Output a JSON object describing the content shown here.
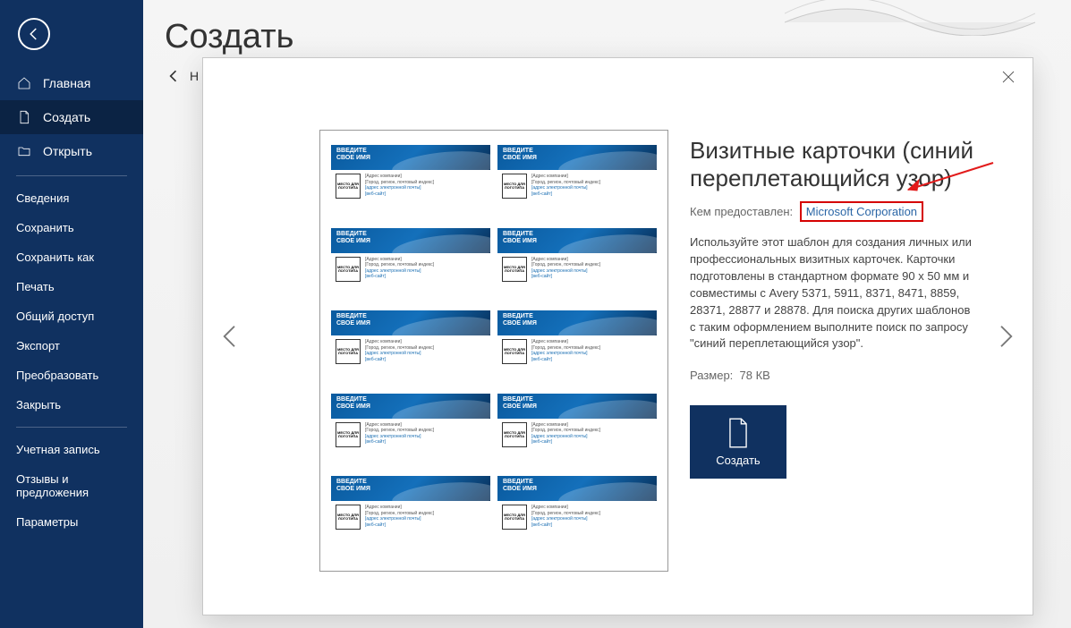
{
  "sidebar": {
    "nav": [
      {
        "label": "Главная"
      },
      {
        "label": "Создать"
      },
      {
        "label": "Открыть"
      }
    ],
    "sub1": [
      {
        "label": "Сведения"
      },
      {
        "label": "Сохранить"
      },
      {
        "label": "Сохранить как"
      },
      {
        "label": "Печать"
      },
      {
        "label": "Общий доступ"
      },
      {
        "label": "Экспорт"
      },
      {
        "label": "Преобразовать"
      },
      {
        "label": "Закрыть"
      }
    ],
    "sub2": [
      {
        "label": "Учетная запись"
      },
      {
        "label": "Отзывы и предложения"
      },
      {
        "label": "Параметры"
      }
    ]
  },
  "page": {
    "title": "Создать",
    "back_label": "Н"
  },
  "modal": {
    "template_title": "Визитные карточки (синий переплетающийся узор)",
    "provided_label": "Кем предоставлен:",
    "provided_value": "Microsoft Corporation",
    "description": "Используйте этот шаблон для создания личных или профессиональных визитных карточек. Карточки подготовлены в стандартном формате 90 x 50 мм и совместимы с Avery 5371, 5911, 8371, 8471, 8859, 28371, 28877 и 28878. Для поиска других шаблонов с таким оформлением выполните поиск по запросу \"синий переплетающийся узор\".",
    "size_label": "Размер:",
    "size_value": "78 КВ",
    "create_label": "Создать"
  },
  "card": {
    "header_line1": "ВВЕДИТЕ",
    "header_line2": "СВОЕ ИМЯ",
    "logo": "МЕСТО ДЛЯ ЛОГОТИПА",
    "detail1": "[Адрес компании]",
    "detail2": "[Город, регион, почтовый индекс]",
    "detail3": "[адрес электронной почты]",
    "detail4": "[веб-сайт]"
  }
}
